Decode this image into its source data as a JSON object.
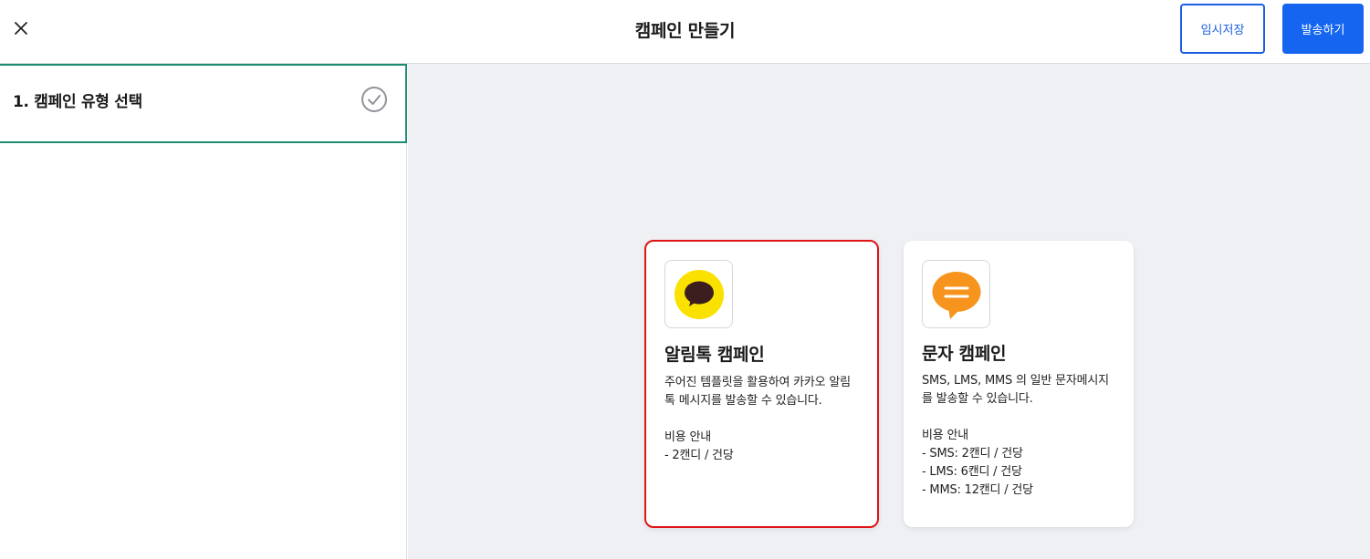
{
  "header": {
    "title": "캠페인 만들기",
    "save_label": "임시저장",
    "send_label": "발송하기"
  },
  "sidebar": {
    "steps": [
      {
        "label": "1. 캠페인 유형 선택",
        "completed": true
      }
    ]
  },
  "cards": [
    {
      "title": "알림톡 캠페인",
      "desc_lines": [
        "주어진 템플릿을 활용하여 카카오 알림",
        "톡 메시지를 발송할 수 있습니다."
      ],
      "cost_lines": [
        "비용 안내",
        "- 2캔디 / 건당"
      ],
      "selected": true,
      "icon": "kakao-talk-icon"
    },
    {
      "title": "문자 캠페인",
      "desc_lines": [
        "SMS, LMS, MMS 의 일반 문자메시지",
        "를 발송할 수 있습니다."
      ],
      "cost_lines": [
        "비용 안내",
        "- SMS: 2캔디 / 건당",
        "- LMS: 6캔디 / 건당",
        "- MMS: 12캔디 / 건당"
      ],
      "selected": false,
      "icon": "sms-message-icon"
    }
  ],
  "colors": {
    "accent_blue": "#1565f0",
    "step_border": "#1e8c74",
    "selected_border": "#e01414",
    "kakao_yellow": "#fae100",
    "sms_orange": "#f7941d"
  }
}
